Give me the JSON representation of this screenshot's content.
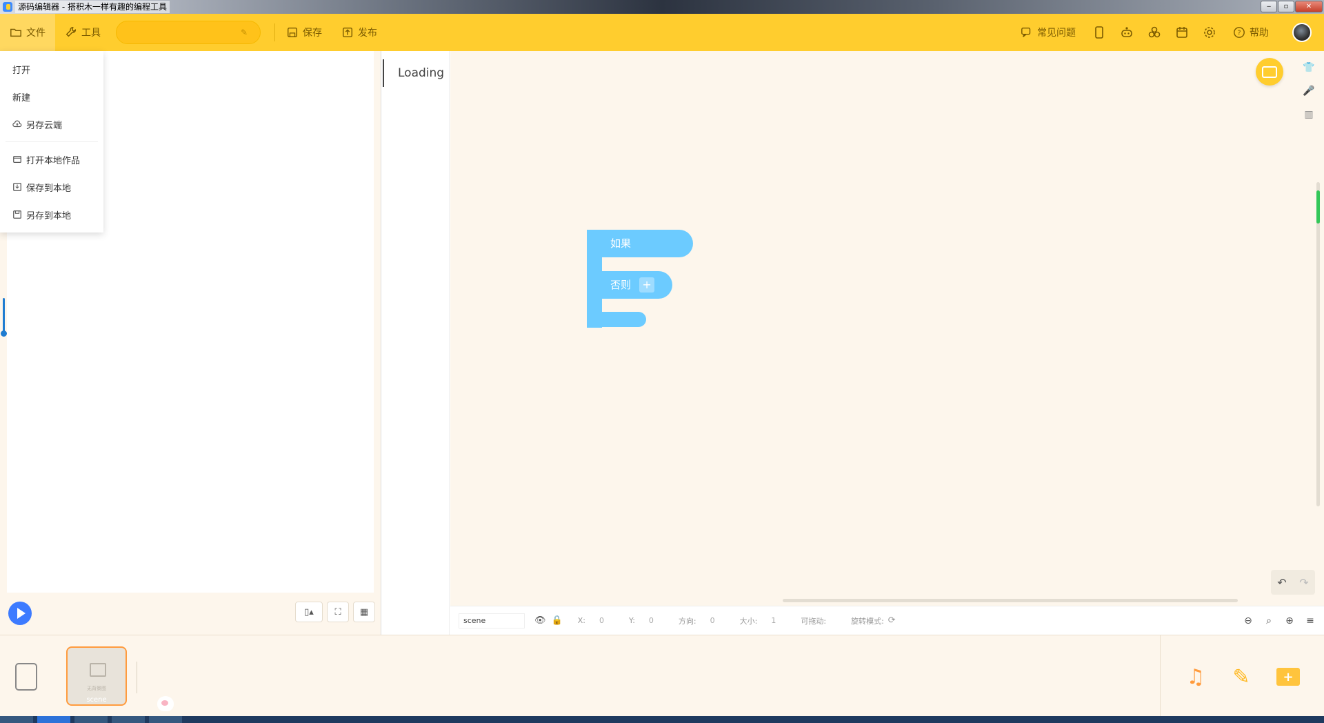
{
  "window": {
    "title": "源码编辑器 - 搭积木一样有趣的编程工具",
    "controls": [
      "‒",
      "▫",
      "✕"
    ]
  },
  "toolbar": {
    "file_label": "文件",
    "tools_label": "工具",
    "project_name": "",
    "save_label": "保存",
    "publish_label": "发布",
    "faq_label": "常见问题",
    "help_label": "帮助",
    "accent_color": "#ffcd2e"
  },
  "file_menu": {
    "items": [
      {
        "label": "打开",
        "icon": ""
      },
      {
        "label": "新建",
        "icon": ""
      },
      {
        "label": "另存云端",
        "icon": "cloud-upload-icon"
      },
      {
        "label": "打开本地作品",
        "icon": "folder-open-icon"
      },
      {
        "label": "保存到本地",
        "icon": "download-icon"
      },
      {
        "label": "另存到本地",
        "icon": "save-as-icon"
      }
    ]
  },
  "palette": {
    "loading_text": "Loading"
  },
  "blocks": {
    "if_label": "如果",
    "else_label": "否则",
    "else_plus": "+",
    "color": "#6ccbff"
  },
  "properties": {
    "sprite_name": "scene",
    "x_label": "X:",
    "x_value": "0",
    "y_label": "Y:",
    "y_value": "0",
    "direction_label": "方向:",
    "direction_value": "0",
    "size_label": "大小:",
    "size_value": "1",
    "draggable_label": "可拖动:",
    "rotation_label": "旋转模式:"
  },
  "sprites": {
    "items": [
      {
        "name": "scene",
        "thumb_caption": "无背景图"
      }
    ],
    "selected_border_color": "#ff9b3d"
  }
}
